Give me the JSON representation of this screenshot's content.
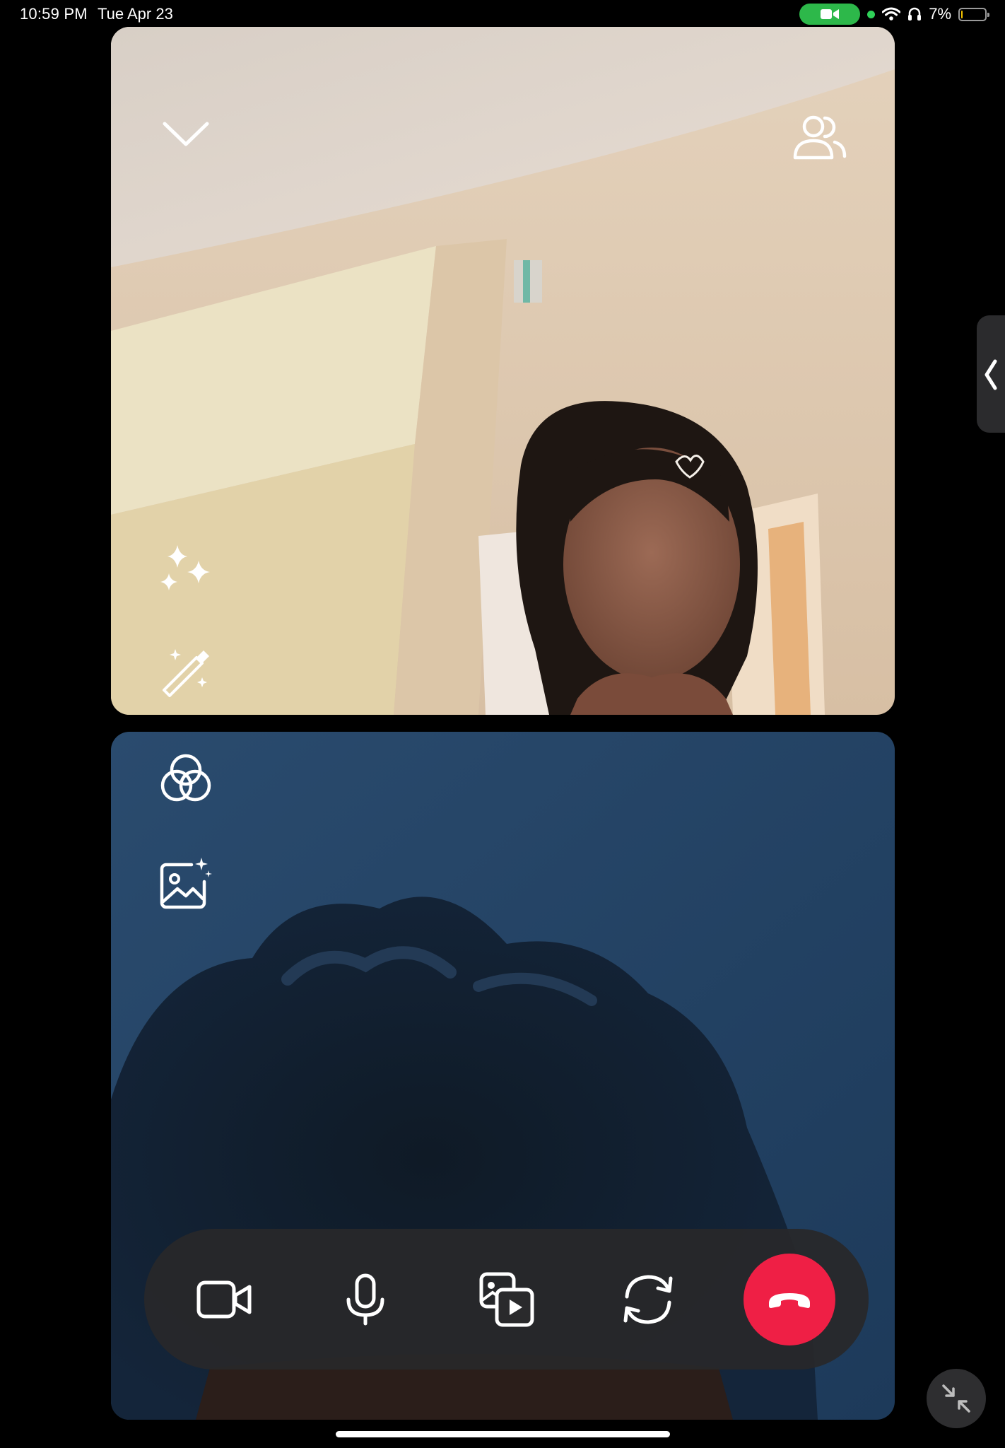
{
  "status_bar": {
    "time": "10:59 PM",
    "date": "Tue Apr 23",
    "battery_percent_label": "7%",
    "battery_level": 0.07,
    "camera_indicator_color": "#2db84a",
    "icons": [
      "video-camera-indicator-icon",
      "green-dot-icon",
      "wifi-icon",
      "headphones-icon",
      "battery-icon"
    ]
  },
  "top_tile": {
    "icons": [
      "chevron-down-icon",
      "participants-icon",
      "sparkles-icon",
      "magic-wand-icon"
    ]
  },
  "bottom_tile": {
    "icons": [
      "filters-icon",
      "background-image-icon"
    ]
  },
  "side_panel": {
    "icon": "chevron-left-icon"
  },
  "controls": {
    "buttons": [
      "camera-icon",
      "microphone-icon",
      "media-share-icon",
      "flip-camera-icon",
      "end-call-icon"
    ],
    "end_call_color": "#ef1f45"
  },
  "minimize": {
    "icon": "minimize-icon"
  }
}
